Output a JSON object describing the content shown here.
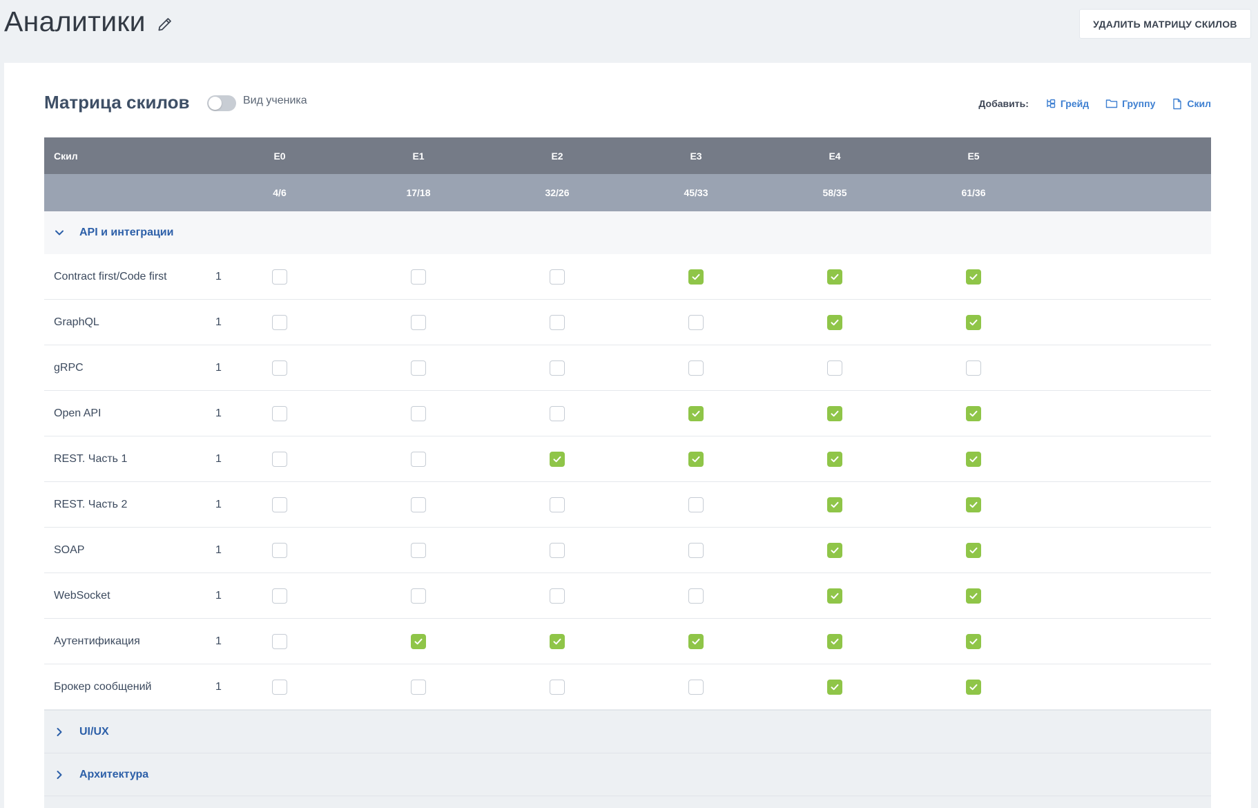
{
  "page": {
    "title": "Аналитики",
    "delete_label": "УДАЛИТЬ МАТРИЦУ СКИЛОВ"
  },
  "matrix": {
    "title": "Матрица скилов",
    "student_view_label": "Вид ученика",
    "student_view_on": false,
    "add_label": "Добавить:",
    "add_links": [
      {
        "label": "Грейд",
        "icon": "grade-tree-icon"
      },
      {
        "label": "Группу",
        "icon": "folder-icon"
      },
      {
        "label": "Скил",
        "icon": "file-icon"
      }
    ],
    "skill_header": "Скил",
    "grades": [
      {
        "name": "E0",
        "score": "4/6"
      },
      {
        "name": "E1",
        "score": "17/18"
      },
      {
        "name": "E2",
        "score": "32/26"
      },
      {
        "name": "E3",
        "score": "45/33"
      },
      {
        "name": "E4",
        "score": "58/35"
      },
      {
        "name": "E5",
        "score": "61/36"
      }
    ],
    "groups": [
      {
        "name": "API и интеграции",
        "expanded": true,
        "skills": [
          {
            "name": "Contract first/Code first",
            "weight": "1",
            "checks": [
              false,
              false,
              false,
              true,
              true,
              true
            ]
          },
          {
            "name": "GraphQL",
            "weight": "1",
            "checks": [
              false,
              false,
              false,
              false,
              true,
              true
            ]
          },
          {
            "name": "gRPC",
            "weight": "1",
            "checks": [
              false,
              false,
              false,
              false,
              false,
              false
            ]
          },
          {
            "name": "Open API",
            "weight": "1",
            "checks": [
              false,
              false,
              false,
              true,
              true,
              true
            ]
          },
          {
            "name": "REST. Часть 1",
            "weight": "1",
            "checks": [
              false,
              false,
              true,
              true,
              true,
              true
            ]
          },
          {
            "name": "REST. Часть 2",
            "weight": "1",
            "checks": [
              false,
              false,
              false,
              false,
              true,
              true
            ]
          },
          {
            "name": "SOAP",
            "weight": "1",
            "checks": [
              false,
              false,
              false,
              false,
              true,
              true
            ]
          },
          {
            "name": "WebSocket",
            "weight": "1",
            "checks": [
              false,
              false,
              false,
              false,
              true,
              true
            ]
          },
          {
            "name": "Аутентификация",
            "weight": "1",
            "checks": [
              false,
              true,
              true,
              true,
              true,
              true
            ]
          },
          {
            "name": "Брокер сообщений",
            "weight": "1",
            "checks": [
              false,
              false,
              false,
              false,
              true,
              true
            ]
          }
        ]
      },
      {
        "name": "UI/UX",
        "expanded": false,
        "skills": []
      },
      {
        "name": "Архитектура",
        "expanded": false,
        "skills": []
      }
    ],
    "colors": {
      "header_bg": "#757b87",
      "subheader_bg": "#9aa3b2",
      "check_on": "#8fc548",
      "link": "#3d7fd1",
      "group_label": "#2c5fa8"
    }
  }
}
